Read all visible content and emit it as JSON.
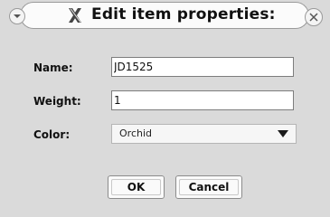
{
  "window": {
    "title": "Edit item properties:",
    "icons": {
      "left_button": "chevron-down-icon",
      "app_icon": "x-logo-icon",
      "close_button": "close-icon"
    }
  },
  "form": {
    "name_label": "Name:",
    "name_value": "JD1525",
    "weight_label": "Weight:",
    "weight_value": "1",
    "color_label": "Color:",
    "color_value": "Orchid"
  },
  "buttons": {
    "ok_label": "OK",
    "cancel_label": "Cancel"
  }
}
